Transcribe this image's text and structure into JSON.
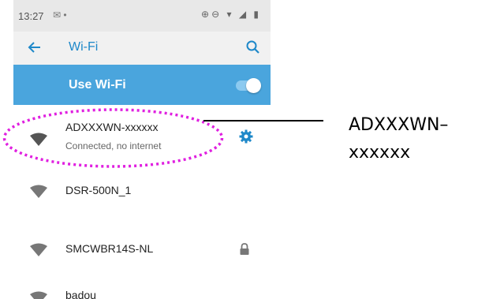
{
  "status_bar": {
    "time": "13:27",
    "left_icons": "✉ •",
    "right_icons": "⊕⊖ ▾ ◢ ▮"
  },
  "app_bar": {
    "title": "Wi-Fi",
    "back_icon": "arrow-left",
    "search_icon": "search"
  },
  "use_wifi": {
    "label": "Use Wi-Fi",
    "enabled": true,
    "accent": "#4aa5dd"
  },
  "networks": [
    {
      "ssid": "ADXXXWN-xxxxxx",
      "status": "Connected, no internet",
      "connected": true,
      "locked": false
    },
    {
      "ssid": "DSR-500N_1",
      "status": "",
      "connected": false,
      "locked": false
    },
    {
      "ssid": "SMCWBR14S-NL",
      "status": "",
      "connected": false,
      "locked": true
    },
    {
      "ssid": "badou",
      "status": "",
      "connected": false,
      "locked": false
    }
  ],
  "annotation": {
    "line1": "ADXXXWN–",
    "line2": "xxxxxx",
    "highlight_color": "#e020e0"
  }
}
